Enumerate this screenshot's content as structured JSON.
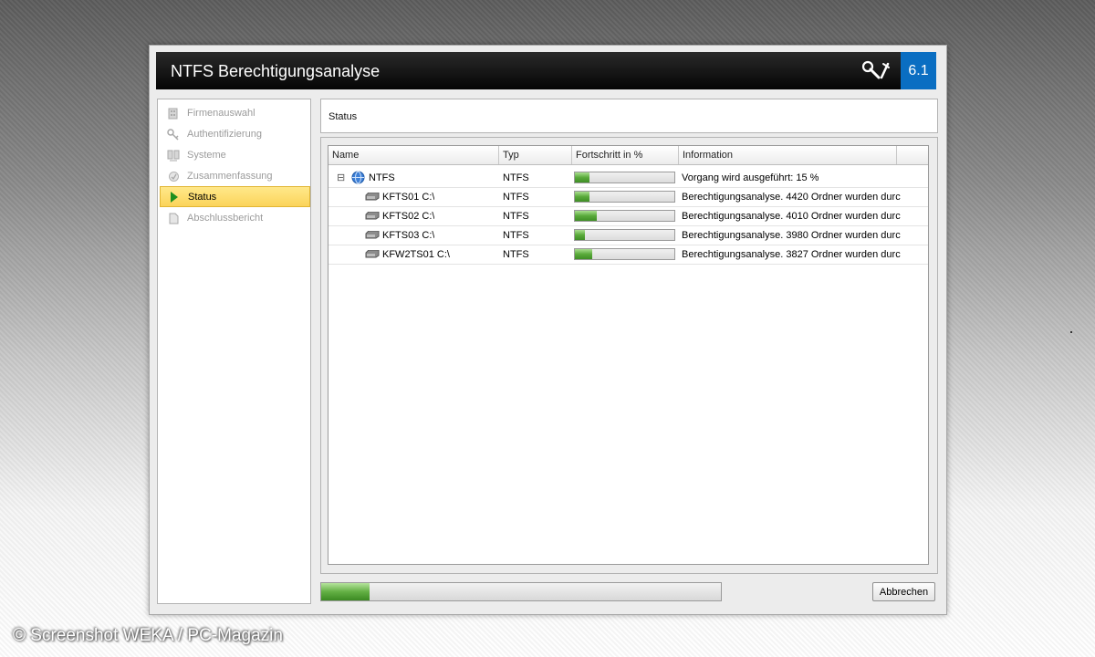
{
  "window": {
    "title": "NTFS Berechtigungsanalyse",
    "version": "6.1"
  },
  "sidebar": {
    "items": [
      {
        "label": "Firmenauswahl",
        "icon": "building-icon",
        "state": "disabled"
      },
      {
        "label": "Authentifizierung",
        "icon": "key-icon",
        "state": "disabled"
      },
      {
        "label": "Systeme",
        "icon": "servers-icon",
        "state": "disabled"
      },
      {
        "label": "Zusammenfassung",
        "icon": "summary-icon",
        "state": "disabled"
      },
      {
        "label": "Status",
        "icon": "play-arrow-icon",
        "state": "active"
      },
      {
        "label": "Abschlussbericht",
        "icon": "report-icon",
        "state": "disabled"
      }
    ]
  },
  "status_panel": {
    "header": "Status"
  },
  "grid": {
    "columns": [
      "Name",
      "Typ",
      "Fortschritt in %",
      "Information"
    ],
    "rows": [
      {
        "name": "NTFS",
        "type": "NTFS",
        "progress": 15,
        "info": "Vorgang wird ausgeführt: 15 %",
        "level": 0,
        "icon": "globe-icon",
        "expander": "⊟"
      },
      {
        "name": "KFTS01 C:\\",
        "type": "NTFS",
        "progress": 15,
        "info": "Berechtigungsanalyse. 4420 Ordner wurden durc...",
        "level": 1,
        "icon": "drive-icon"
      },
      {
        "name": "KFTS02 C:\\",
        "type": "NTFS",
        "progress": 22,
        "info": "Berechtigungsanalyse. 4010 Ordner wurden durc...",
        "level": 1,
        "icon": "drive-icon"
      },
      {
        "name": "KFTS03 C:\\",
        "type": "NTFS",
        "progress": 10,
        "info": "Berechtigungsanalyse. 3980 Ordner wurden durc...",
        "level": 1,
        "icon": "drive-icon"
      },
      {
        "name": "KFW2TS01 C:\\",
        "type": "NTFS",
        "progress": 17,
        "info": "Berechtigungsanalyse. 3827 Ordner wurden durc...",
        "level": 1,
        "icon": "drive-icon"
      }
    ]
  },
  "footer": {
    "overall_progress": 12,
    "cancel_label": "Abbrechen"
  },
  "watermark": "© Screenshot WEKA / PC-Magazin",
  "colors": {
    "titlebar": "#050505",
    "version_badge": "#0a6ec2",
    "active_nav": "#fbd45a",
    "progress_green": "#5aaa3b"
  }
}
